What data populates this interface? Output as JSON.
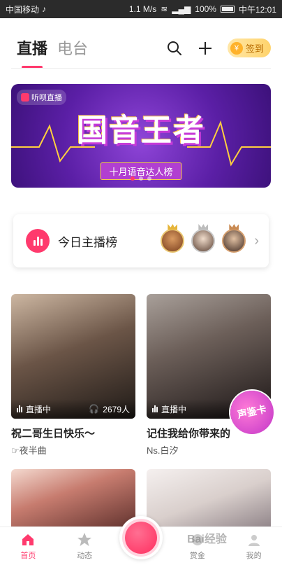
{
  "status_bar": {
    "carrier": "中国移动",
    "speed": "1.1 M/s",
    "battery": "100%",
    "time": "中午12:01"
  },
  "header": {
    "tabs": [
      {
        "label": "直播",
        "active": true
      },
      {
        "label": "电台",
        "active": false
      }
    ],
    "checkin_label": "签到",
    "accent_color": "#ff3a6d"
  },
  "banner": {
    "tag": "听呗直播",
    "title": "国音王者",
    "subtitle": "十月语音达人榜"
  },
  "rank": {
    "label": "今日主播榜"
  },
  "cards": [
    {
      "status": "直播中",
      "listeners": "2679人",
      "title": "祝二哥生日快乐～",
      "subtitle": "☞夜半曲"
    },
    {
      "status": "直播中",
      "listeners": "",
      "title": "记住我给你带来的",
      "subtitle": "Ns.白汐",
      "sticker": "声鉴卡"
    },
    {
      "status": "",
      "listeners": "",
      "title": "",
      "subtitle": ""
    },
    {
      "status": "",
      "listeners": "",
      "title": "",
      "subtitle": ""
    }
  ],
  "bottom_nav": {
    "items": [
      {
        "label": "首页",
        "icon": "home-icon",
        "active": true
      },
      {
        "label": "动态",
        "icon": "star-face-icon",
        "active": false
      },
      {
        "label": "赏金",
        "icon": "coin-icon",
        "active": false
      },
      {
        "label": "我的",
        "icon": "profile-icon",
        "active": false
      }
    ]
  },
  "watermark": "Bai经验"
}
